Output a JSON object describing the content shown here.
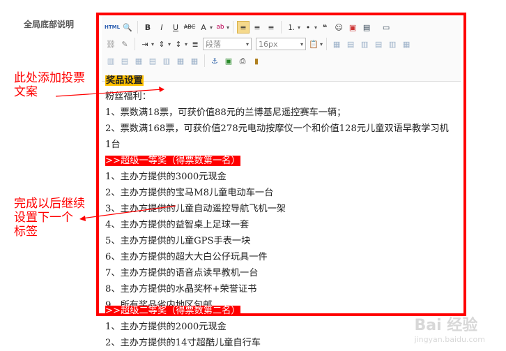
{
  "field_label": "全局底部说明",
  "toolbar": {
    "row1": [
      "HTML",
      "🔍",
      "B",
      "I",
      "U",
      "ABC",
      "A",
      "ab",
      "≡",
      "≡",
      "≡",
      "≔",
      "≔",
      "❝",
      "☺",
      "▣",
      "▤",
      "▭"
    ],
    "row2_paragraph_select": "段落",
    "row2_fontsize_select": "16px"
  },
  "content": {
    "title": "奖品设置",
    "line_fans": "粉丝福利：",
    "line_fans_1": "1、票数满18票，可获价值88元的兰博基尼遥控赛车一辆；",
    "line_fans_2": "2、票数满168票，可获价值278元电动按摩仪一个和价值128元儿童双语早教学习机1台",
    "section_1": ">>超级一等奖（得票数第一名）",
    "prizes": [
      "1、主办方提供的3000元现金",
      "2、主办方提供的宝马M8儿童电动车一台",
      "3、主办方提供的儿童自动遥控导航飞机一架",
      "4、主办方提供的益智桌上足球一套",
      "5、主办方提供的儿童GPS手表一块",
      "6、主办方提供的超大大白公仔玩具一件",
      "7、主办方提供的语音点读早教机一台",
      "8、主办方提供的水晶奖杯+荣誉证书",
      "9、所有奖品省内地区包邮"
    ],
    "section_2": ">>超级二等奖（得票数第二名）",
    "prizes_2": [
      "1、主办方提供的2000元现金",
      "2、主办方提供的14寸超酷儿童自行车"
    ]
  },
  "annotations": {
    "top_line1": "此处添加投票",
    "top_line2": "文案",
    "bottom_line1": "完成以后继续",
    "bottom_line2": "设置下一个",
    "bottom_line3": "标签"
  },
  "watermark": {
    "brand": "Bai 经验",
    "url": "jingyan.baidu.com"
  }
}
